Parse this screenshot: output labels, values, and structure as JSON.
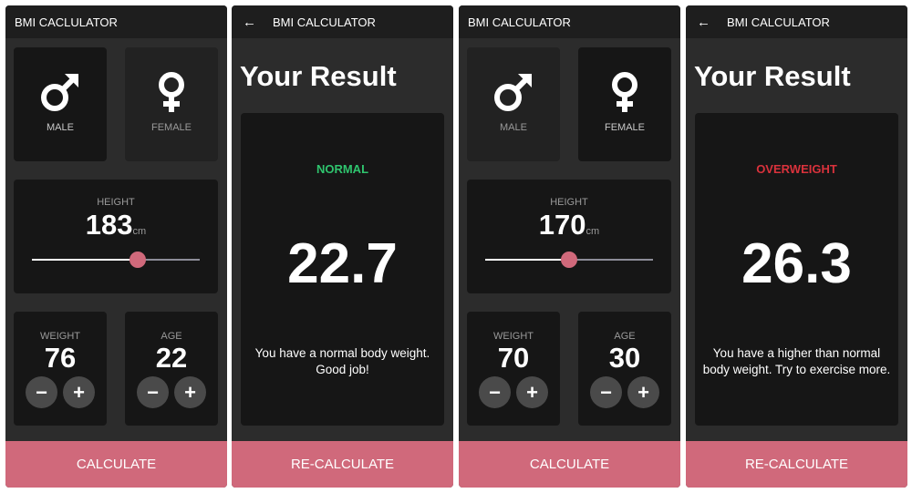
{
  "calc1": {
    "title": "BMI CACLULATOR",
    "male_label": "MALE",
    "female_label": "FEMALE",
    "height_label": "HEIGHT",
    "height_value": "183",
    "height_unit": "cm",
    "height_fraction": 0.63,
    "weight_label": "WEIGHT",
    "weight_value": "76",
    "age_label": "AGE",
    "age_value": "22",
    "minus": "−",
    "plus": "+",
    "button": "CALCULATE"
  },
  "result1": {
    "back": "←",
    "title": "BMI CALCULATOR",
    "heading": "Your Result",
    "status": "NORMAL",
    "status_color": "#2fc46e",
    "bmi": "22.7",
    "message": "You have a normal body weight. Good job!",
    "button": "RE-CALCULATE"
  },
  "calc2": {
    "title": "BMI CALCULATOR",
    "male_label": "MALE",
    "female_label": "FEMALE",
    "height_label": "HEIGHT",
    "height_value": "170",
    "height_unit": "cm",
    "height_fraction": 0.5,
    "weight_label": "WEIGHT",
    "weight_value": "70",
    "age_label": "AGE",
    "age_value": "30",
    "minus": "−",
    "plus": "+",
    "button": "CALCULATE"
  },
  "result2": {
    "back": "←",
    "title": "BMI CALCULATOR",
    "heading": "Your Result",
    "status": "OVERWEIGHT",
    "status_color": "#d9323c",
    "bmi": "26.3",
    "message": "You have a higher than normal body weight. Try to exercise more.",
    "button": "RE-CALCULATE"
  },
  "colors": {
    "accent": "#d0697b",
    "card": "#161616",
    "background": "#2c2c2c"
  }
}
